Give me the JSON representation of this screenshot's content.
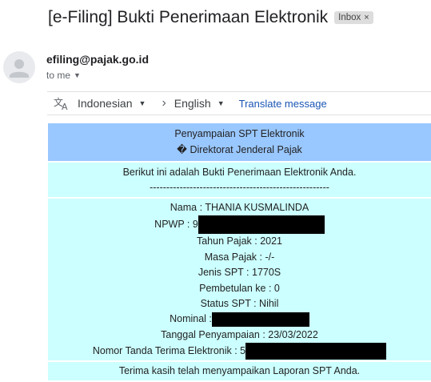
{
  "email": {
    "subject": "[e-Filing] Bukti Penerimaan Elektronik",
    "label": "Inbox",
    "label_close": "×",
    "sender": "efiling@pajak.go.id",
    "recipient": "to me"
  },
  "translate": {
    "source_lang": "Indonesian",
    "target_lang": "English",
    "action": "Translate message"
  },
  "body": {
    "header_line1": "Penyampaian SPT Elektronik",
    "header_line2": "� Direktorat Jenderal Pajak",
    "intro": "Berikut ini adalah Bukti Penerimaan Elektronik Anda.",
    "separator": "------------------------------------------------------",
    "fields": {
      "nama": "Nama : THANIA KUSMALINDA",
      "npwp": "NPWP : 9",
      "tahun_pajak": "Tahun Pajak : 2021",
      "masa_pajak": "Masa Pajak : -/-",
      "jenis_spt": "Jenis SPT : 1770S",
      "pembetulan": "Pembetulan ke : 0",
      "status_spt": "Status SPT : Nihil",
      "nominal": "Nominal :",
      "tanggal": "Tanggal Penyampaian : 23/03/2022",
      "nomor_tanda": "Nomor Tanda Terima Elektronik : 5"
    },
    "closing": "Terima kasih telah menyampaikan Laporan SPT Anda."
  },
  "colors": {
    "header_bg": "#99c7ff",
    "body_bg": "#ccffff",
    "link": "#1a55b5"
  },
  "icons": [
    "person-icon",
    "translate-icon",
    "dropdown-caret-icon",
    "chevron-right-icon"
  ]
}
